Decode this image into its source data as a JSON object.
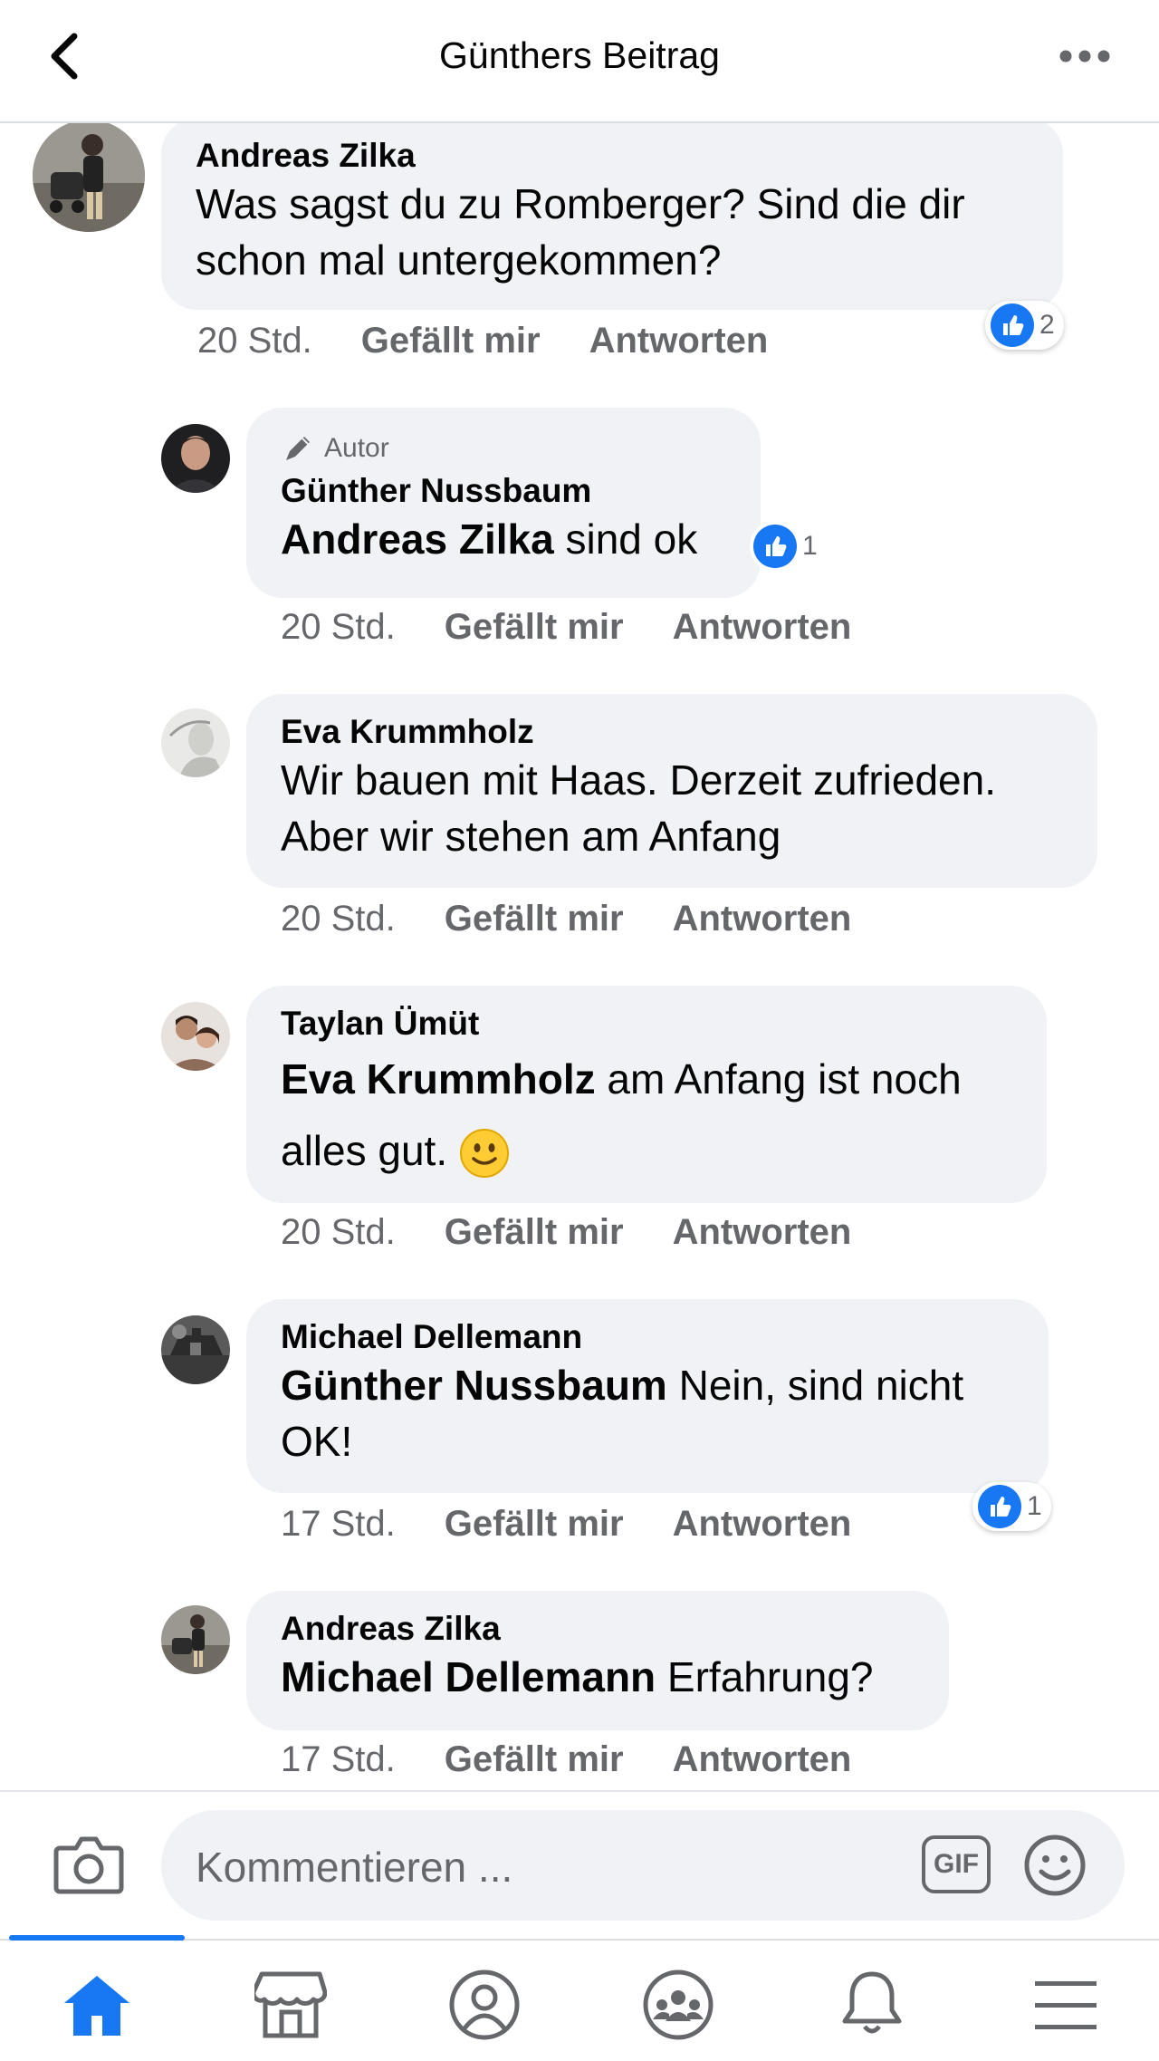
{
  "header": {
    "title": "Günthers Beitrag"
  },
  "comments": [
    {
      "name": "Andreas Zilka",
      "text": "Was sagst du zu Romberger? Sind die dir schon mal untergekommen?",
      "time": "20 Std.",
      "like": "Gefällt mir",
      "reply": "Antworten",
      "likes": "2"
    },
    {
      "badge": "Autor",
      "name": "Günther Nussbaum",
      "mention": "Andreas Zilka",
      "text": "sind ok",
      "time": "20 Std.",
      "like": "Gefällt mir",
      "reply": "Antworten",
      "likes": "1"
    },
    {
      "name": "Eva Krummholz",
      "text": "Wir bauen mit Haas. Derzeit zufrieden. Aber wir stehen am Anfang",
      "time": "20 Std.",
      "like": "Gefällt mir",
      "reply": "Antworten"
    },
    {
      "name": "Taylan Ümüt",
      "mention": "Eva Krummholz",
      "text": "am Anfang ist noch alles gut.",
      "emoji": "🙂",
      "time": "20 Std.",
      "like": "Gefällt mir",
      "reply": "Antworten"
    },
    {
      "name": "Michael Dellemann",
      "mention": "Günther Nussbaum",
      "text": "Nein, sind nicht OK!",
      "time": "17 Std.",
      "like": "Gefällt mir",
      "reply": "Antworten",
      "likes": "1"
    },
    {
      "name": "Andreas Zilka",
      "mention": "Michael Dellemann",
      "text": "Erfahrung?",
      "time": "17 Std.",
      "like": "Gefällt mir",
      "reply": "Antworten"
    }
  ],
  "composer": {
    "placeholder": "Kommentieren ...",
    "gif_label": "GIF"
  },
  "tabs": [
    "home-icon",
    "marketplace-icon",
    "profile-icon",
    "groups-icon",
    "notifications-icon",
    "menu-icon"
  ],
  "colors": {
    "accent": "#1877f2",
    "bubble": "#f0f2f5",
    "secondary_text": "#65676b"
  }
}
